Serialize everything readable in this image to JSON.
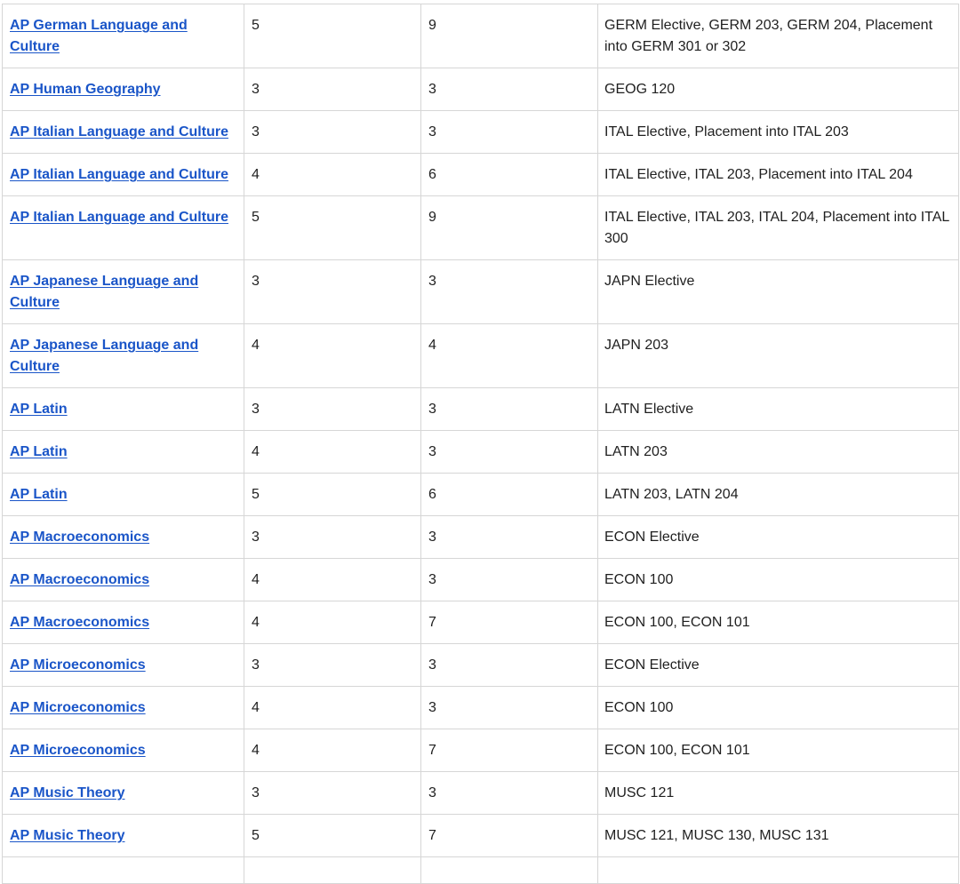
{
  "table": {
    "rows": [
      {
        "exam": "AP German Language and Culture",
        "score": "5",
        "credits": "9",
        "equivalent": "GERM Elective, GERM 203, GERM 204, Placement into GERM 301 or 302"
      },
      {
        "exam": "AP Human Geography",
        "score": "3",
        "credits": "3",
        "equivalent": "GEOG 120"
      },
      {
        "exam": "AP Italian Language and Culture",
        "score": "3",
        "credits": "3",
        "equivalent": "ITAL Elective, Placement into ITAL 203"
      },
      {
        "exam": "AP Italian Language and Culture",
        "score": "4",
        "credits": "6",
        "equivalent": "ITAL Elective, ITAL 203, Placement into ITAL 204"
      },
      {
        "exam": "AP Italian Language and Culture",
        "score": "5",
        "credits": "9",
        "equivalent": "ITAL Elective, ITAL 203, ITAL 204, Placement into ITAL 300"
      },
      {
        "exam": "AP Japanese Language and Culture",
        "score": "3",
        "credits": "3",
        "equivalent": "JAPN Elective"
      },
      {
        "exam": "AP Japanese Language and Culture",
        "score": "4",
        "credits": "4",
        "equivalent": "JAPN 203"
      },
      {
        "exam": "AP Latin",
        "score": "3",
        "credits": "3",
        "equivalent": "LATN Elective"
      },
      {
        "exam": "AP Latin",
        "score": "4",
        "credits": "3",
        "equivalent": "LATN 203"
      },
      {
        "exam": "AP Latin",
        "score": "5",
        "credits": "6",
        "equivalent": "LATN 203, LATN 204"
      },
      {
        "exam": "AP Macroeconomics",
        "score": "3",
        "credits": "3",
        "equivalent": "ECON Elective"
      },
      {
        "exam": "AP Macroeconomics",
        "score": "4",
        "credits": "3",
        "equivalent": "ECON 100"
      },
      {
        "exam": "AP Macroeconomics",
        "score": "4",
        "credits": "7",
        "equivalent": "ECON 100, ECON 101"
      },
      {
        "exam": "AP Microeconomics",
        "score": "3",
        "credits": "3",
        "equivalent": "ECON Elective"
      },
      {
        "exam": "AP Microeconomics",
        "score": "4",
        "credits": "3",
        "equivalent": "ECON 100"
      },
      {
        "exam": "AP Microeconomics",
        "score": "4",
        "credits": "7",
        "equivalent": "ECON 100, ECON 101"
      },
      {
        "exam": "AP Music Theory",
        "score": "3",
        "credits": "3",
        "equivalent": "MUSC 121"
      },
      {
        "exam": "AP Music Theory",
        "score": "5",
        "credits": "7",
        "equivalent": "MUSC 121, MUSC 130, MUSC 131"
      }
    ]
  },
  "colors": {
    "link": "#1a55c8",
    "text": "#1f1f1f",
    "border": "#d6d6d6"
  }
}
